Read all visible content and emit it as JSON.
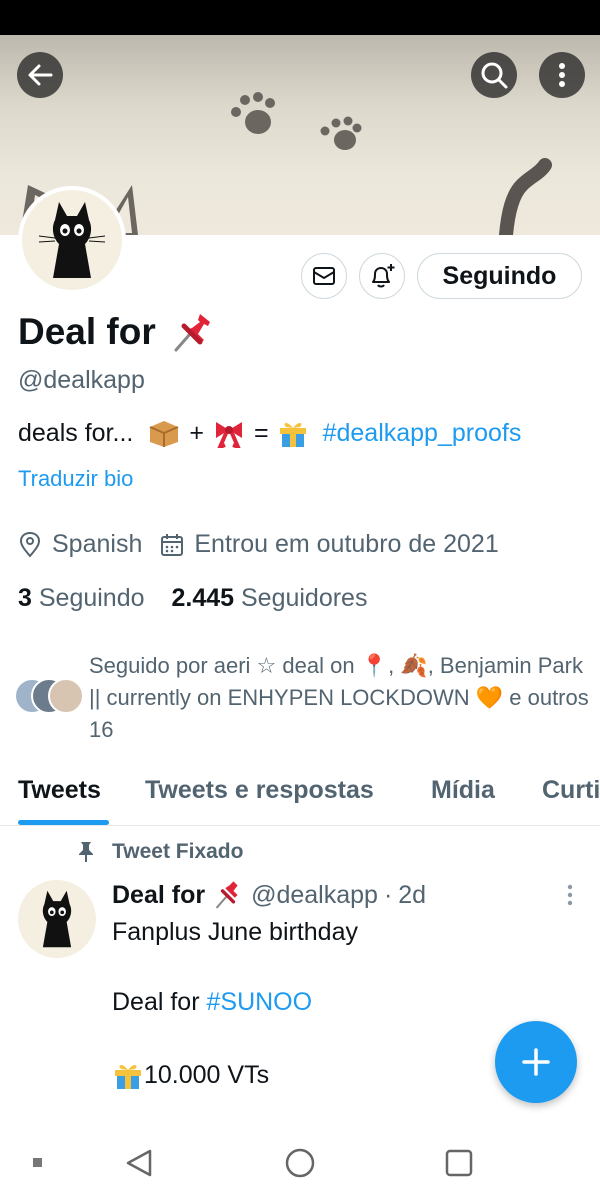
{
  "header": {
    "back_icon": "arrow-left-icon",
    "search_icon": "search-icon",
    "more_icon": "more-vertical-icon"
  },
  "profile": {
    "name": "Deal for",
    "name_emoji": "pushpin",
    "handle": "@dealkapp",
    "following_button": "Seguindo",
    "bio": {
      "text": "deals for...",
      "plus": "+",
      "equals": "=",
      "hashtag": "#dealkapp_proofs"
    },
    "translate_bio": "Traduzir bio",
    "location": "Spanish",
    "joined": "Entrou em outubro de 2021",
    "following_count": "3",
    "following_label": "Seguindo",
    "followers_count": "2.445",
    "followers_label": "Seguidores",
    "followed_by": "Seguido por aeri ☆ deal on 📍, 🍂, Benjamin Park || currently on ENHYPEN LOCKDOWN 🧡 e outros 16"
  },
  "tabs": [
    {
      "label": "Tweets",
      "active": true
    },
    {
      "label": "Tweets e respostas",
      "active": false
    },
    {
      "label": "Mídia",
      "active": false
    },
    {
      "label": "Curti",
      "active": false
    }
  ],
  "pinned_tweet": {
    "pinned_label": "Tweet Fixado",
    "author_name": "Deal for",
    "author_handle": "@dealkapp",
    "separator": "·",
    "time": "2d",
    "line1": "Fanplus June birthday",
    "line2_prefix": "Deal for",
    "line2_hashtag": "#SUNOO",
    "line3": "10.000 VTs"
  },
  "colors": {
    "accent": "#1d9bf0",
    "text_primary": "#0f1419",
    "text_secondary": "#536471",
    "banner": "#efe9dd"
  }
}
